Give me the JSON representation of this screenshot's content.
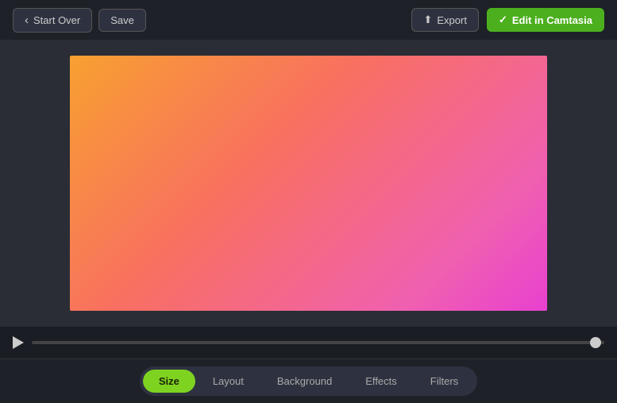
{
  "toolbar": {
    "start_over_label": "Start Over",
    "save_label": "Save",
    "export_label": "Export",
    "edit_camtasia_label": "Edit in Camtasia"
  },
  "tabs": [
    {
      "id": "size",
      "label": "Size",
      "active": true
    },
    {
      "id": "layout",
      "label": "Layout",
      "active": false
    },
    {
      "id": "background",
      "label": "Background",
      "active": false
    },
    {
      "id": "effects",
      "label": "Effects",
      "active": false
    },
    {
      "id": "filters",
      "label": "Filters",
      "active": false
    }
  ],
  "canvas": {
    "gradient_desc": "orange to pink gradient background"
  },
  "icons": {
    "chevron_left": "‹",
    "upload": "↑",
    "check": "✓",
    "play": "▶"
  }
}
